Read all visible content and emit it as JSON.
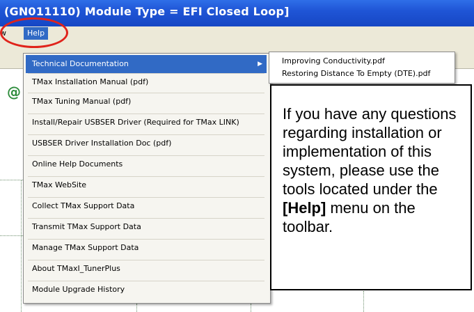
{
  "window": {
    "title": "(GN011110) Module Type = EFI Closed Loop]"
  },
  "menubar": {
    "view_label": "w",
    "help_label": "Help"
  },
  "app": {
    "at_symbol": "@"
  },
  "help_menu": {
    "items": [
      {
        "label": "Technical Documentation",
        "has_submenu": true,
        "active": true
      },
      {
        "label": "TMax Installation Manual (pdf)"
      },
      {
        "label": "TMax Tuning Manual (pdf)"
      },
      {
        "label": "Install/Repair USBSER Driver (Required for TMax LINK)"
      },
      {
        "label": " USBSER Driver Installation Doc (pdf)"
      },
      {
        "label": "Online Help Documents"
      },
      {
        "label": "TMax WebSite"
      },
      {
        "label": "Collect TMax Support Data"
      },
      {
        "label": "Transmit TMax Support Data"
      },
      {
        "label": "Manage TMax Support Data"
      },
      {
        "label": "About TMaxI_TunerPlus"
      },
      {
        "label": "Module Upgrade History"
      }
    ],
    "submenu_arrow": "▶"
  },
  "submenu": {
    "items": [
      {
        "label": "Improving Conductivity.pdf"
      },
      {
        "label": "Restoring Distance To Empty (DTE).pdf"
      }
    ]
  },
  "callout": {
    "text_before": "If you have any questions regarding installation or implementation of this system, please use the tools located under the ",
    "bold": "[Help]",
    "text_after": " menu on the toolbar."
  },
  "colors": {
    "titlebar": "#1f55d6",
    "menu_highlight": "#316ac5",
    "annotation_circle": "#e0231b"
  }
}
